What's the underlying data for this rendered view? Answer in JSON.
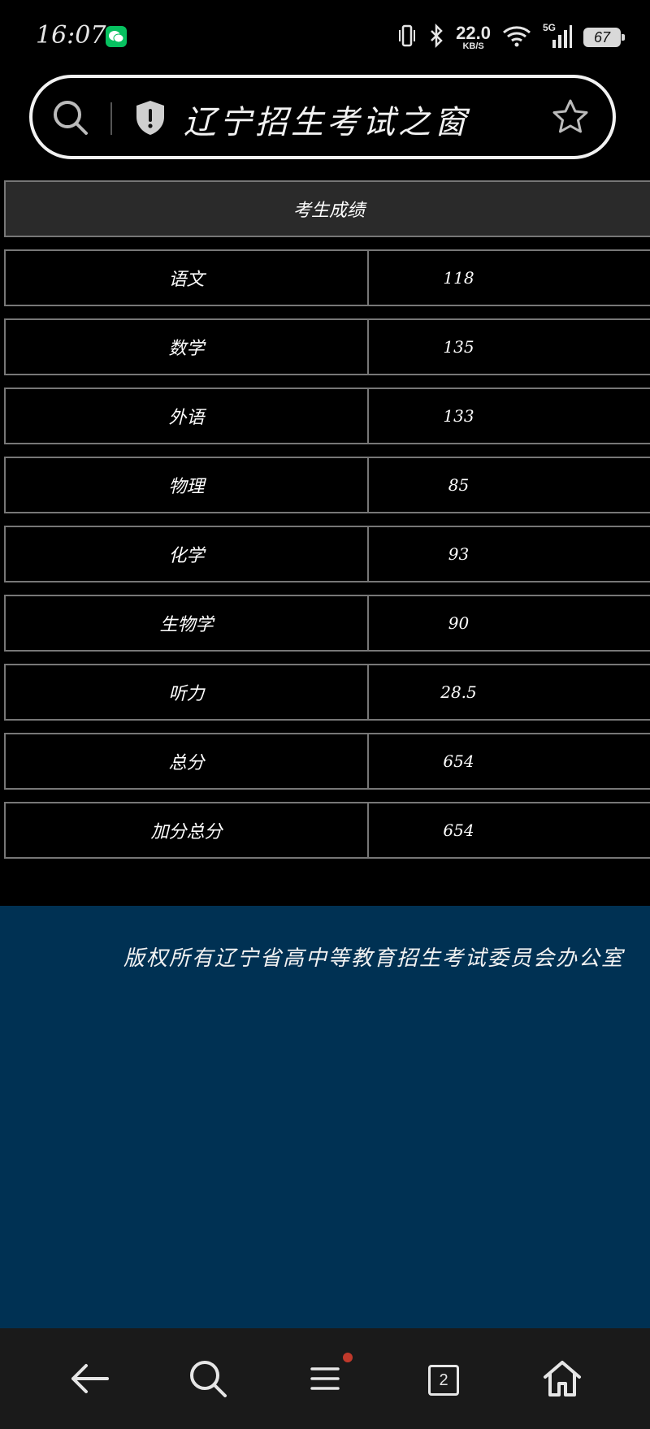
{
  "status": {
    "time": "16:07",
    "speed_value": "22.0",
    "speed_unit": "KB/S",
    "network": "5G",
    "battery": "67"
  },
  "address_bar": {
    "title": "辽宁招生考试之窗"
  },
  "table": {
    "header": "考生成绩",
    "rows": [
      {
        "subject": "语文",
        "score": "118"
      },
      {
        "subject": "数学",
        "score": "135"
      },
      {
        "subject": "外语",
        "score": "133"
      },
      {
        "subject": "物理",
        "score": "85"
      },
      {
        "subject": "化学",
        "score": "93"
      },
      {
        "subject": "生物学",
        "score": "90"
      },
      {
        "subject": "听力",
        "score": "28.5"
      },
      {
        "subject": "总分",
        "score": "654"
      },
      {
        "subject": "加分总分",
        "score": "654"
      }
    ]
  },
  "footer": {
    "copyright": "版权所有辽宁省高中等教育招生考试委员会办公室"
  },
  "nav": {
    "tab_count": "2"
  },
  "colors": {
    "footer_bg": "#003153",
    "page_bg": "#000000",
    "wechat_green": "#07c160",
    "notification_dot": "#c0392b"
  }
}
